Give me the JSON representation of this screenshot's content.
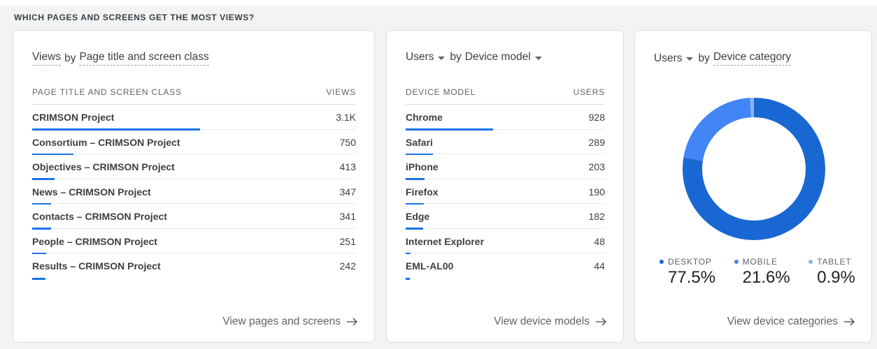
{
  "section_title": "WHICH PAGES AND SCREENS GET THE MOST VIEWS?",
  "cards": {
    "pages": {
      "title_metric": "Views",
      "title_by": "by",
      "title_dimension": "Page title and screen class",
      "col_dimension": "PAGE TITLE AND SCREEN CLASS",
      "col_metric": "VIEWS",
      "rows": [
        {
          "label": "CRIMSON Project",
          "value": "3.1K",
          "share": 1.0
        },
        {
          "label": "Consortium – CRIMSON Project",
          "value": "750",
          "share": 0.245
        },
        {
          "label": "Objectives – CRIMSON Project",
          "value": "413",
          "share": 0.135
        },
        {
          "label": "News – CRIMSON Project",
          "value": "347",
          "share": 0.113
        },
        {
          "label": "Contacts – CRIMSON Project",
          "value": "341",
          "share": 0.111
        },
        {
          "label": "People – CRIMSON Project",
          "value": "251",
          "share": 0.082
        },
        {
          "label": "Results – CRIMSON Project",
          "value": "242",
          "share": 0.079
        }
      ],
      "link": "View pages and screens"
    },
    "devices": {
      "title_metric": "Users",
      "title_by": "by",
      "title_dimension": "Device model",
      "col_dimension": "DEVICE MODEL",
      "col_metric": "USERS",
      "rows": [
        {
          "label": "Chrome",
          "value": "928",
          "share": 1.0
        },
        {
          "label": "Safari",
          "value": "289",
          "share": 0.311
        },
        {
          "label": "iPhone",
          "value": "203",
          "share": 0.219
        },
        {
          "label": "Firefox",
          "value": "190",
          "share": 0.205
        },
        {
          "label": "Edge",
          "value": "182",
          "share": 0.196
        },
        {
          "label": "Internet Explorer",
          "value": "48",
          "share": 0.052
        },
        {
          "label": "EML-AL00",
          "value": "44",
          "share": 0.047
        }
      ],
      "link": "View device models"
    },
    "categories": {
      "title_metric": "Users",
      "title_by": "by",
      "title_dimension": "Device category",
      "link": "View device categories"
    }
  },
  "chart_data": {
    "type": "pie",
    "categories": [
      "DESKTOP",
      "MOBILE",
      "TABLET"
    ],
    "values": [
      77.5,
      21.6,
      0.9
    ],
    "labels": [
      "77.5%",
      "21.6%",
      "0.9%"
    ],
    "colors": [
      "#1967d2",
      "#4285f4",
      "#8ab4f8"
    ]
  },
  "colors": {
    "bar": "#1a73e8",
    "card_border": "#dadce0",
    "background": "#f1f3f4"
  }
}
